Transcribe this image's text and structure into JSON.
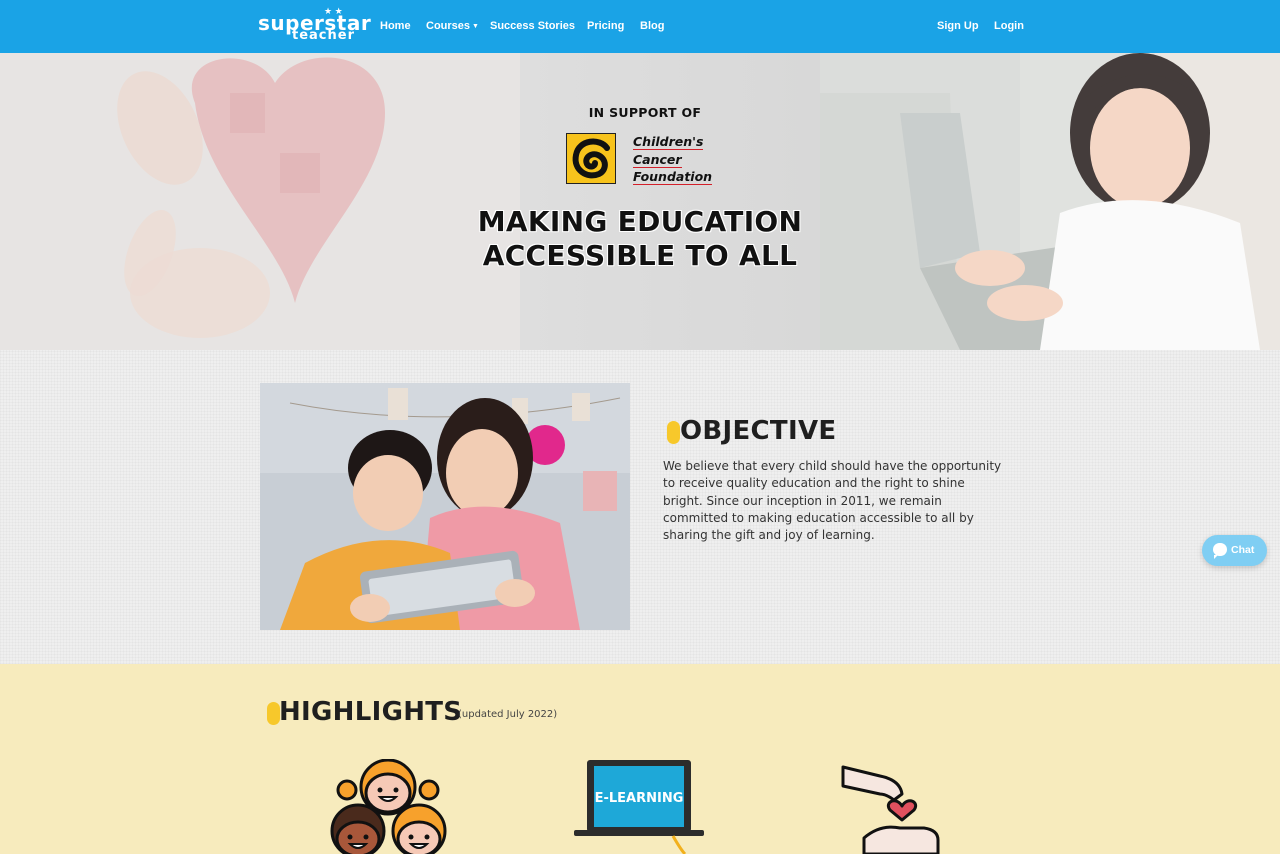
{
  "nav": {
    "logo_line1": "superstar",
    "logo_line2": "teacher",
    "logo_stars": "★ ★",
    "home": "Home",
    "courses": "Courses",
    "success_stories": "Success Stories",
    "pricing": "Pricing",
    "blog": "Blog",
    "sign_up": "Sign Up",
    "login": "Login"
  },
  "hero": {
    "support_label": "IN SUPPORT OF",
    "foundation_line1": "Children's",
    "foundation_line2": "Cancer",
    "foundation_line3": "Foundation",
    "title_line1": "MAKING EDUCATION",
    "title_line2": "ACCESSIBLE TO ALL"
  },
  "objective": {
    "title": "OBJECTIVE",
    "text": "We believe that every child should have the opportunity to receive quality education and the right to shine bright. Since our inception in 2011, we remain committed to making education accessible to all by sharing the gift and joy of learning."
  },
  "highlights": {
    "title": "HIGHLIGHTS",
    "updated": "(updated July 2022)",
    "elearning_label": "E-LEARNING"
  },
  "chat": {
    "label": "Chat"
  },
  "colors": {
    "navbar": "#1aa3e6",
    "accent_yellow": "#f7c82b",
    "highlights_bg": "#f7ebbd",
    "chat_bg": "#7fcef3"
  }
}
